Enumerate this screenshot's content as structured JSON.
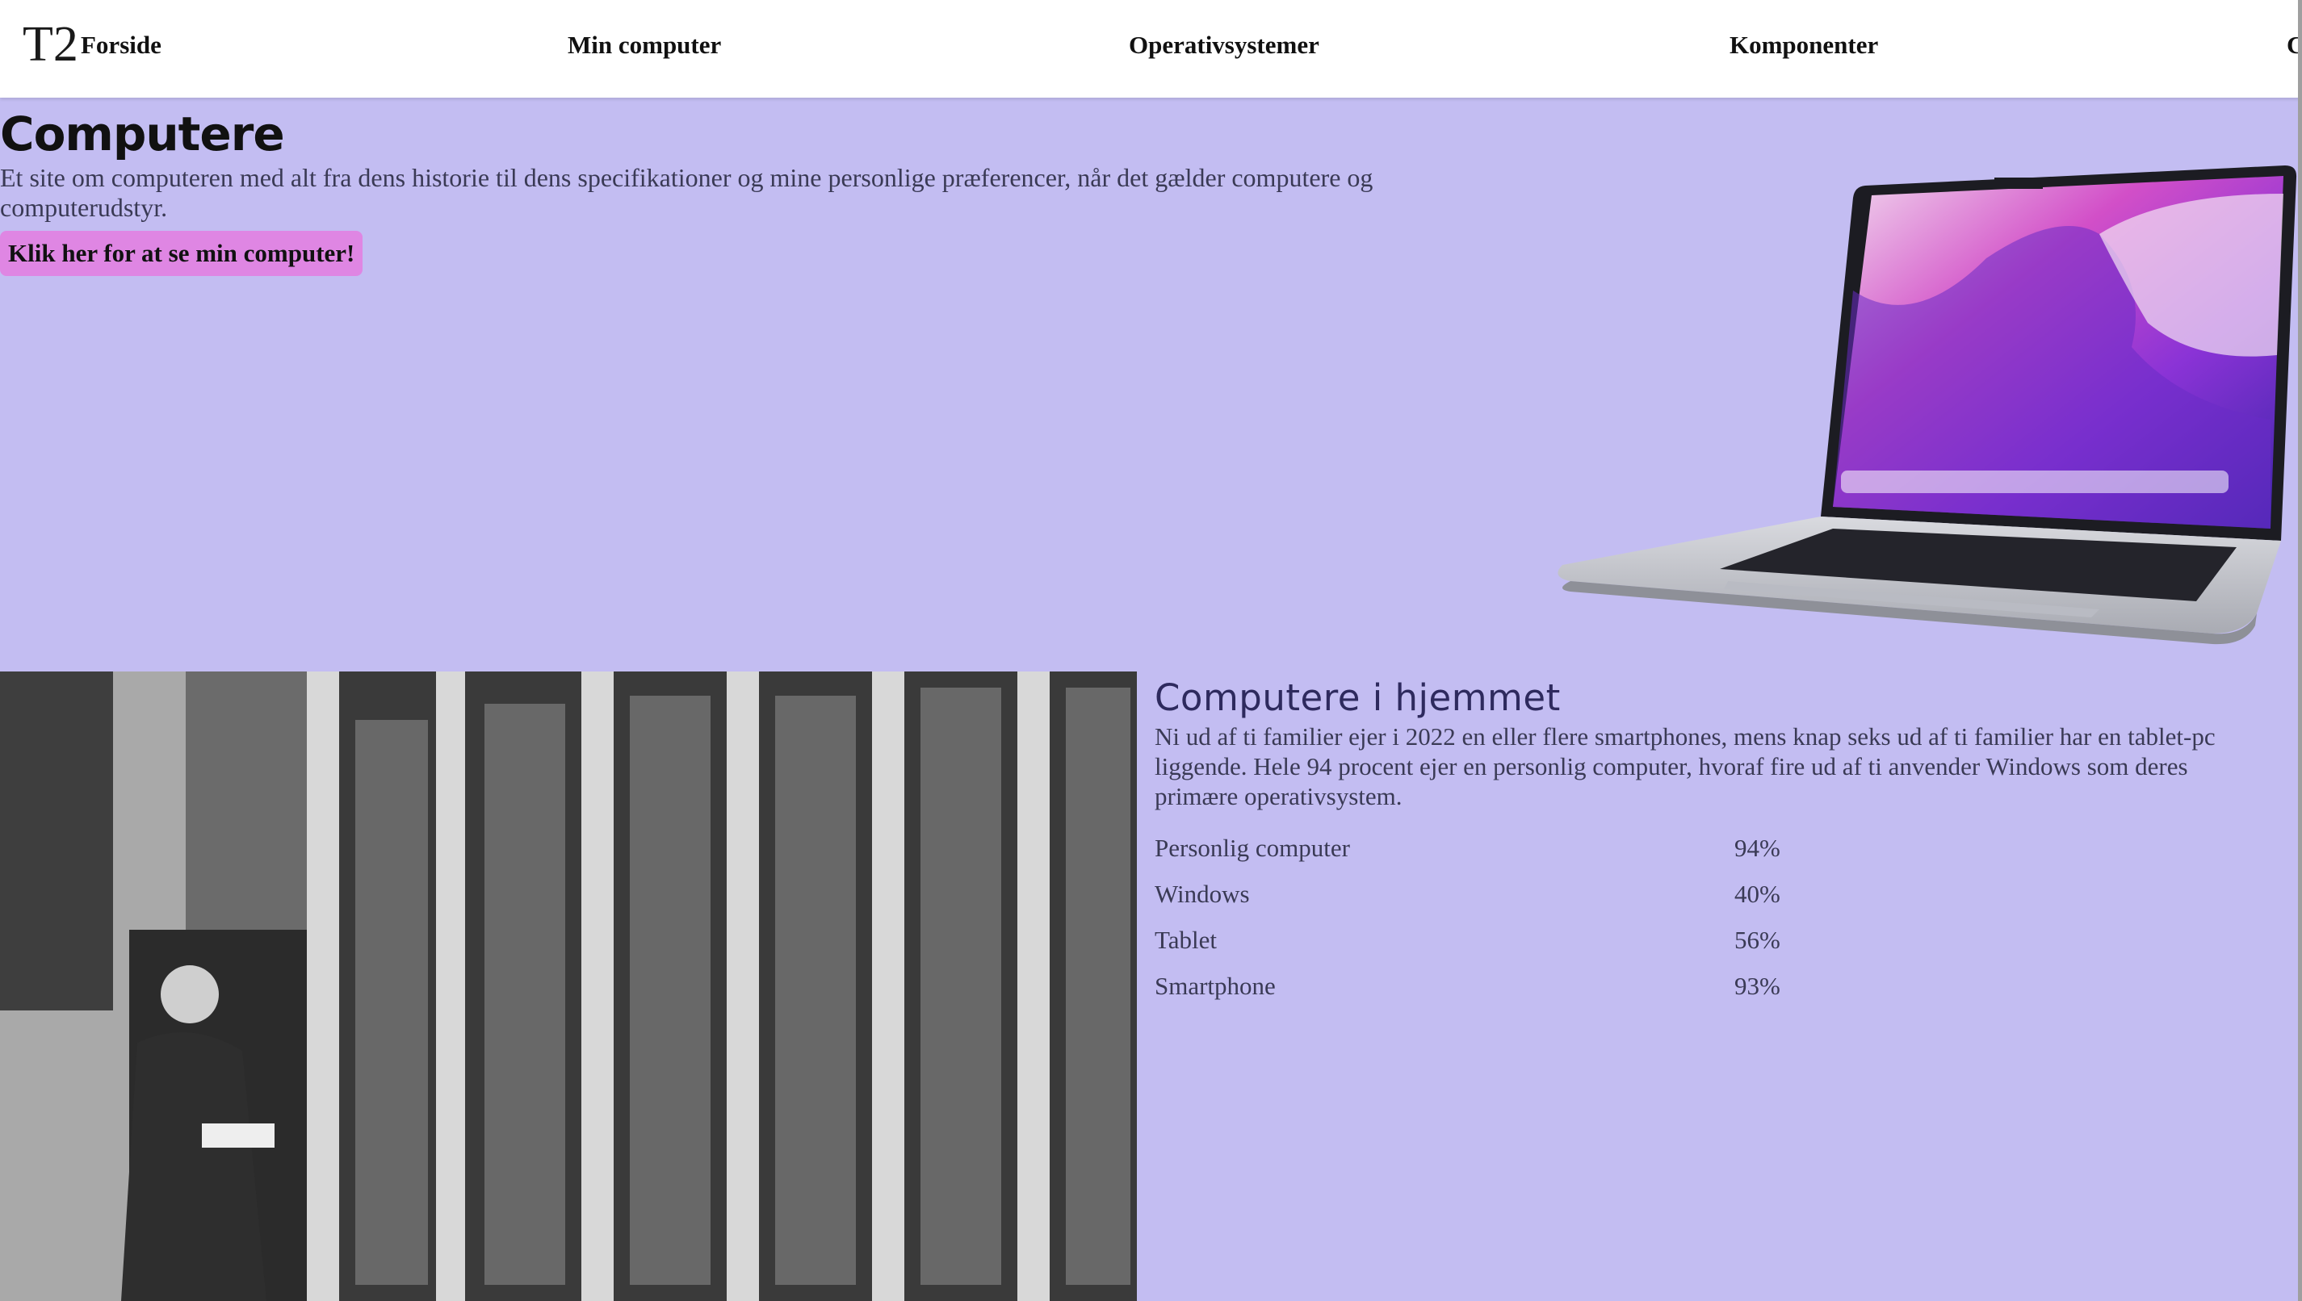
{
  "nav": {
    "logo": "T2",
    "items": [
      {
        "label": "Forside"
      },
      {
        "label": "Min computer"
      },
      {
        "label": "Operativsystemer"
      },
      {
        "label": "Komponenter"
      },
      {
        "label": "C"
      }
    ]
  },
  "hero": {
    "title": "Computere",
    "text": "Et site om computeren med alt fra dens historie til dens specifikationer og mine personlige præferencer, når det gælder computere og computerudstyr.",
    "button_label": "Klik her for at se min computer!"
  },
  "home": {
    "title": "Computere i hjemmet",
    "text": "Ni ud af ti familier ejer i 2022 en eller flere smartphones, mens knap seks ud af ti familier har en tablet-pc liggende. Hele 94 procent ejer en personlig computer, hvoraf fire ud af ti anvender Windows som deres primære operativsystem.",
    "stats": [
      {
        "label": "Personlig computer",
        "value": "94%"
      },
      {
        "label": "Windows",
        "value": "40%"
      },
      {
        "label": "Tablet",
        "value": "56%"
      },
      {
        "label": "Smartphone",
        "value": "93%"
      }
    ]
  },
  "colors": {
    "page_background": "#c3bdf2",
    "button_background": "#df86e3",
    "nav_background": "#ffffff",
    "heading_dark": "#2e2a5e"
  },
  "icons": {
    "laptop": "laptop-image",
    "photo": "vintage-computer-photo"
  }
}
